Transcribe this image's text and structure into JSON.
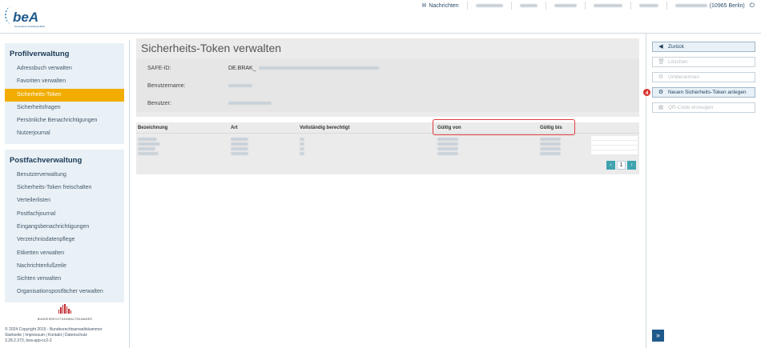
{
  "header": {
    "logo_text": "beA",
    "logo_sub": "besonderes Anwaltspostfach",
    "nav_messages": "Nachrichten",
    "user_location": "(10965 Berlin)"
  },
  "sidebar": {
    "profile_title": "Profilverwaltung",
    "profile_items": [
      {
        "label": "Adressbuch verwalten"
      },
      {
        "label": "Favoriten verwalten"
      },
      {
        "label": "Sicherheits-Token"
      },
      {
        "label": "Sicherheitsfragen"
      },
      {
        "label": "Persönliche Benachrichtigungen"
      },
      {
        "label": "Nutzerjournal"
      }
    ],
    "mailbox_title": "Postfachverwaltung",
    "mailbox_items": [
      {
        "label": "Benutzerverwaltung"
      },
      {
        "label": "Sicherheits-Token freischalten"
      },
      {
        "label": "Verteilerlisten"
      },
      {
        "label": "Postfachjournal"
      },
      {
        "label": "Eingangsbenachrichtigungen"
      },
      {
        "label": "Verzeichnisdatenpflege"
      },
      {
        "label": "Etiketten verwalten"
      },
      {
        "label": "Nachrichtenfußzeile"
      },
      {
        "label": "Sichten verwalten"
      },
      {
        "label": "Organisationspostfächer verwalten"
      }
    ],
    "footer": {
      "org": "BUNDESRECHTSANWALTSKAMMER",
      "copyright": "© 2024 Copyright 2015 - Bundesrechtsanwaltskammer",
      "links": "Startseite | Impressum | Kontakt | Datenschutz",
      "version": "3.28.2.373, bea-app-cc2-2"
    }
  },
  "main": {
    "title": "Sicherheits-Token verwalten",
    "fields": [
      {
        "key": "SAFE-ID:",
        "value": "DE.BRAK_"
      },
      {
        "key": "Benutzername:",
        "value": ""
      },
      {
        "key": "Benutzer:",
        "value": ""
      }
    ],
    "table": {
      "headers": [
        "Bezeichnung",
        "Art",
        "Vollständig berechtigt",
        "Gültig von",
        "Gültig bis"
      ]
    },
    "pager": {
      "prev": "‹",
      "page": "1",
      "next": "›"
    }
  },
  "actions": {
    "back": "Zurück",
    "delete": "Löschen",
    "rename": "Umbenennen",
    "new_token": "Neuen Sicherheits-Token anlegen",
    "qr": "QR-Code erzeugen",
    "step_badge": "4",
    "expand": "»"
  },
  "colors": {
    "accent": "#f2ac00",
    "brand": "#1f5a8c",
    "highlight": "#e03b3b",
    "step": "#d9302c"
  }
}
